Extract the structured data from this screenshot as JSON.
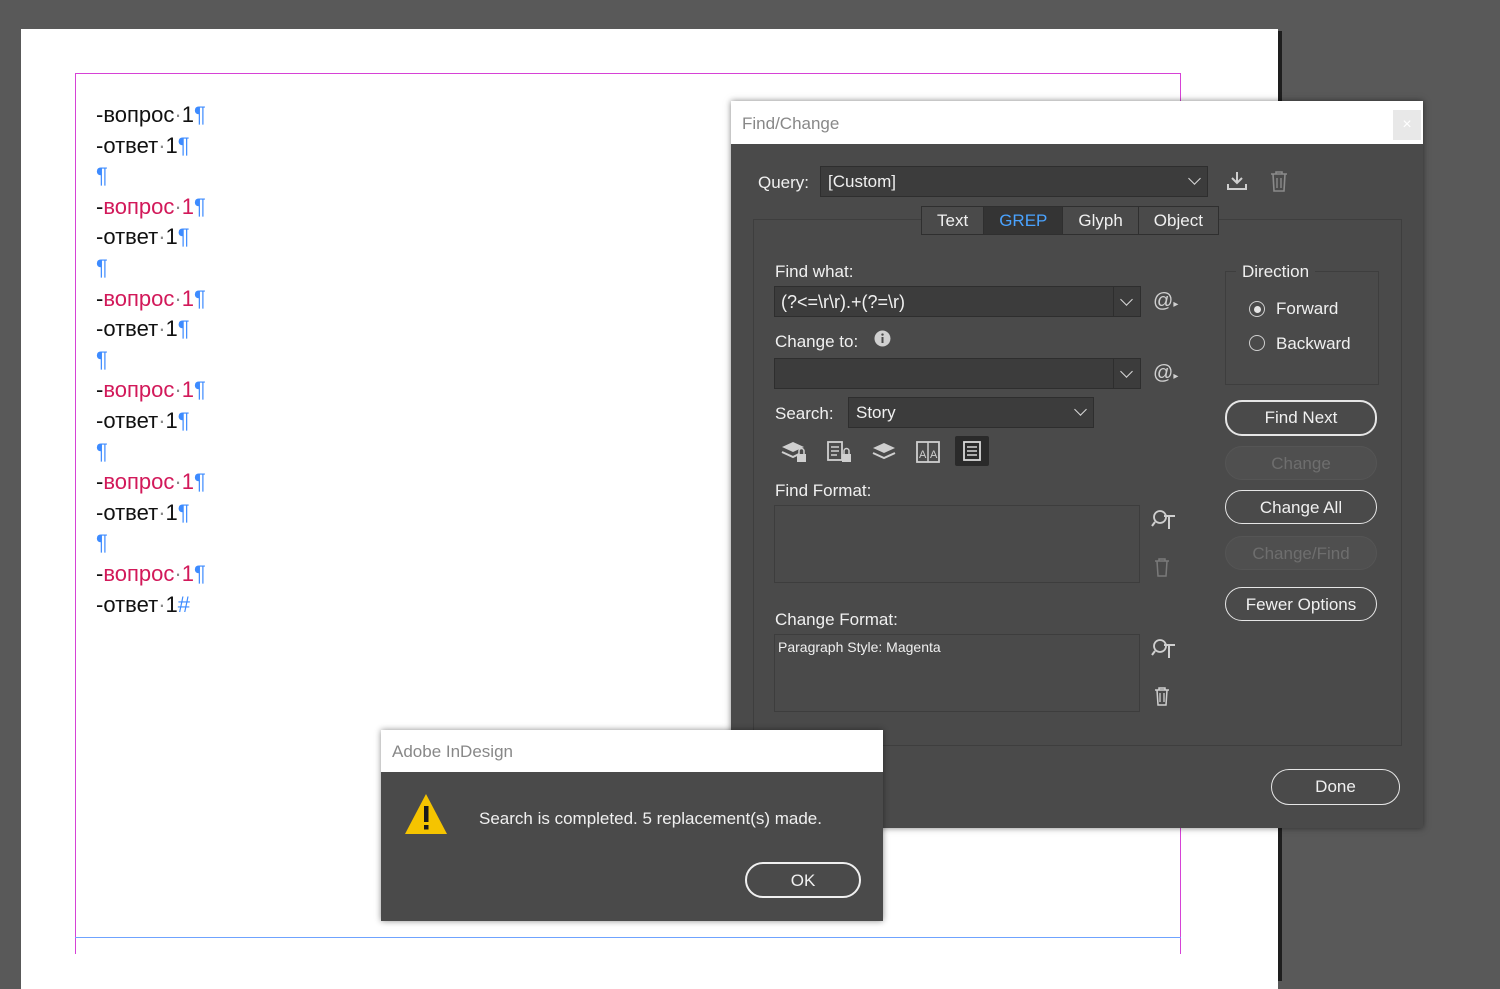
{
  "document": {
    "lines": [
      {
        "dash": "-",
        "text": "вопрос",
        "dot": "·",
        "num": "1",
        "mark": "¶",
        "color": "black"
      },
      {
        "dash": "-",
        "text": "ответ",
        "dot": "·",
        "num": "1",
        "mark": "¶",
        "color": "black"
      },
      {
        "dash": "",
        "text": "",
        "dot": "",
        "num": "",
        "mark": "¶",
        "color": "black"
      },
      {
        "dash": "-",
        "text": "вопрос",
        "dot": "·",
        "num": "1",
        "mark": "¶",
        "color": "magenta"
      },
      {
        "dash": "-",
        "text": "ответ",
        "dot": "·",
        "num": "1",
        "mark": "¶",
        "color": "black"
      },
      {
        "dash": "",
        "text": "",
        "dot": "",
        "num": "",
        "mark": "¶",
        "color": "black"
      },
      {
        "dash": "-",
        "text": "вопрос",
        "dot": "·",
        "num": "1",
        "mark": "¶",
        "color": "magenta"
      },
      {
        "dash": "-",
        "text": "ответ",
        "dot": "·",
        "num": "1",
        "mark": "¶",
        "color": "black"
      },
      {
        "dash": "",
        "text": "",
        "dot": "",
        "num": "",
        "mark": "¶",
        "color": "black"
      },
      {
        "dash": "-",
        "text": "вопрос",
        "dot": "·",
        "num": "1",
        "mark": "¶",
        "color": "magenta"
      },
      {
        "dash": "-",
        "text": "ответ",
        "dot": "·",
        "num": "1",
        "mark": "¶",
        "color": "black"
      },
      {
        "dash": "",
        "text": "",
        "dot": "",
        "num": "",
        "mark": "¶",
        "color": "black"
      },
      {
        "dash": "-",
        "text": "вопрос",
        "dot": "·",
        "num": "1",
        "mark": "¶",
        "color": "magenta"
      },
      {
        "dash": "-",
        "text": "ответ",
        "dot": "·",
        "num": "1",
        "mark": "¶",
        "color": "black"
      },
      {
        "dash": "",
        "text": "",
        "dot": "",
        "num": "",
        "mark": "¶",
        "color": "black"
      },
      {
        "dash": "-",
        "text": "вопрос",
        "dot": "·",
        "num": "1",
        "mark": "¶",
        "color": "magenta"
      },
      {
        "dash": "-",
        "text": "ответ",
        "dot": "·",
        "num": "1",
        "mark": "#",
        "color": "black"
      }
    ],
    "colors": {
      "magenta": "#d2195a",
      "guide": "#d642d6",
      "pilcrow": "#3d8bff"
    }
  },
  "find_change": {
    "title": "Find/Change",
    "close": "×",
    "query_label": "Query:",
    "query_value": "[Custom]",
    "tabs": [
      {
        "label": "Text",
        "active": false
      },
      {
        "label": "GREP",
        "active": true
      },
      {
        "label": "Glyph",
        "active": false
      },
      {
        "label": "Object",
        "active": false
      }
    ],
    "find_what_label": "Find what:",
    "find_what_value": "(?<=\\r\\r).+(?=\\r)",
    "change_to_label": "Change to:",
    "change_to_value": "",
    "search_label": "Search:",
    "search_value": "Story",
    "find_format_label": "Find Format:",
    "find_format_value": "",
    "change_format_label": "Change Format:",
    "change_format_value": "Paragraph Style: Magenta",
    "direction_label": "Direction",
    "direction_forward": "Forward",
    "direction_backward": "Backward",
    "direction_selected": "Forward",
    "buttons": {
      "find_next": "Find Next",
      "change": "Change",
      "change_all": "Change All",
      "change_find": "Change/Find",
      "fewer_options": "Fewer Options",
      "done": "Done"
    },
    "accent": "#4aa3ff"
  },
  "alert": {
    "title": "Adobe InDesign",
    "message": "Search is completed.  5 replacement(s) made.",
    "ok": "OK",
    "icon_color": "#f5c400"
  }
}
